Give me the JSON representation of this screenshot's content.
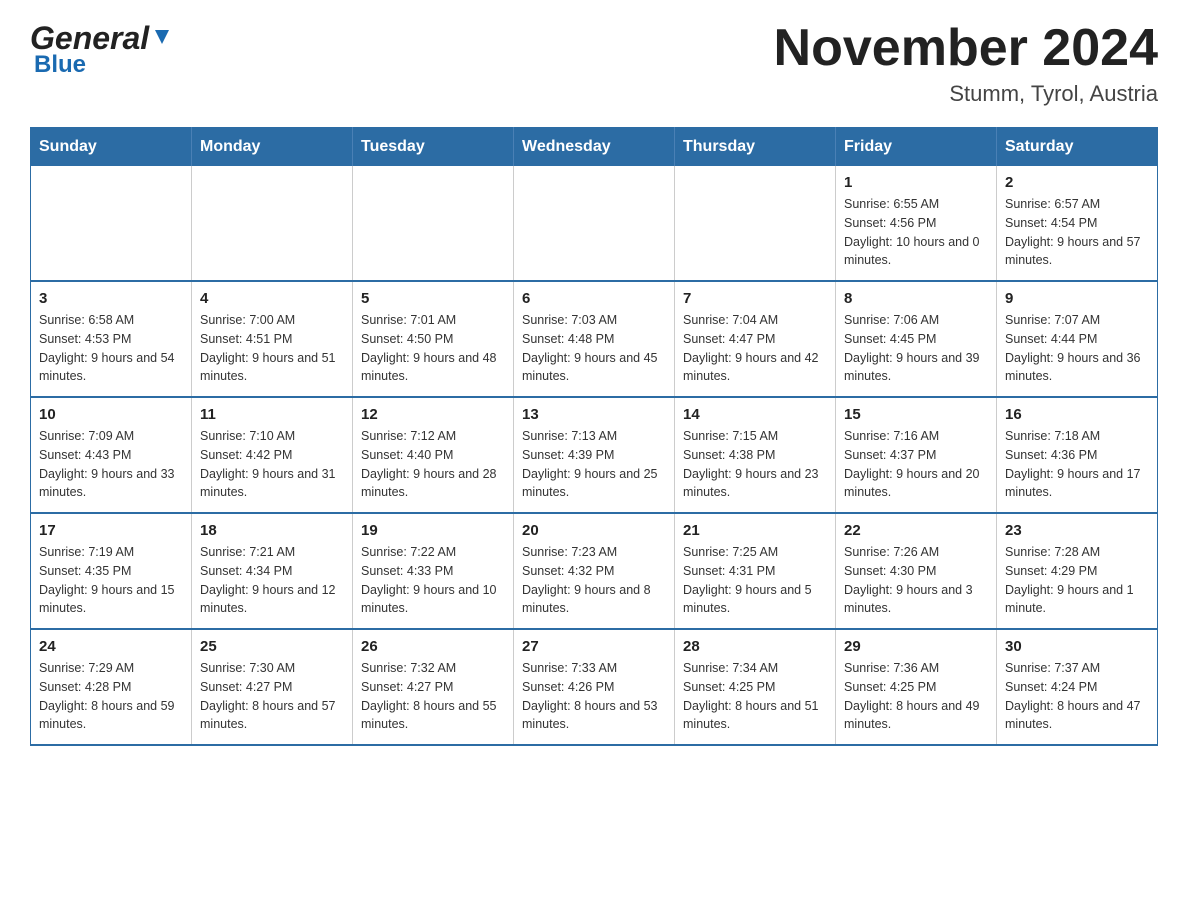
{
  "header": {
    "logo_general": "General",
    "logo_blue": "Blue",
    "month_year": "November 2024",
    "location": "Stumm, Tyrol, Austria"
  },
  "weekdays": [
    "Sunday",
    "Monday",
    "Tuesday",
    "Wednesday",
    "Thursday",
    "Friday",
    "Saturday"
  ],
  "weeks": [
    [
      {
        "day": "",
        "info": ""
      },
      {
        "day": "",
        "info": ""
      },
      {
        "day": "",
        "info": ""
      },
      {
        "day": "",
        "info": ""
      },
      {
        "day": "",
        "info": ""
      },
      {
        "day": "1",
        "info": "Sunrise: 6:55 AM\nSunset: 4:56 PM\nDaylight: 10 hours and 0 minutes."
      },
      {
        "day": "2",
        "info": "Sunrise: 6:57 AM\nSunset: 4:54 PM\nDaylight: 9 hours and 57 minutes."
      }
    ],
    [
      {
        "day": "3",
        "info": "Sunrise: 6:58 AM\nSunset: 4:53 PM\nDaylight: 9 hours and 54 minutes."
      },
      {
        "day": "4",
        "info": "Sunrise: 7:00 AM\nSunset: 4:51 PM\nDaylight: 9 hours and 51 minutes."
      },
      {
        "day": "5",
        "info": "Sunrise: 7:01 AM\nSunset: 4:50 PM\nDaylight: 9 hours and 48 minutes."
      },
      {
        "day": "6",
        "info": "Sunrise: 7:03 AM\nSunset: 4:48 PM\nDaylight: 9 hours and 45 minutes."
      },
      {
        "day": "7",
        "info": "Sunrise: 7:04 AM\nSunset: 4:47 PM\nDaylight: 9 hours and 42 minutes."
      },
      {
        "day": "8",
        "info": "Sunrise: 7:06 AM\nSunset: 4:45 PM\nDaylight: 9 hours and 39 minutes."
      },
      {
        "day": "9",
        "info": "Sunrise: 7:07 AM\nSunset: 4:44 PM\nDaylight: 9 hours and 36 minutes."
      }
    ],
    [
      {
        "day": "10",
        "info": "Sunrise: 7:09 AM\nSunset: 4:43 PM\nDaylight: 9 hours and 33 minutes."
      },
      {
        "day": "11",
        "info": "Sunrise: 7:10 AM\nSunset: 4:42 PM\nDaylight: 9 hours and 31 minutes."
      },
      {
        "day": "12",
        "info": "Sunrise: 7:12 AM\nSunset: 4:40 PM\nDaylight: 9 hours and 28 minutes."
      },
      {
        "day": "13",
        "info": "Sunrise: 7:13 AM\nSunset: 4:39 PM\nDaylight: 9 hours and 25 minutes."
      },
      {
        "day": "14",
        "info": "Sunrise: 7:15 AM\nSunset: 4:38 PM\nDaylight: 9 hours and 23 minutes."
      },
      {
        "day": "15",
        "info": "Sunrise: 7:16 AM\nSunset: 4:37 PM\nDaylight: 9 hours and 20 minutes."
      },
      {
        "day": "16",
        "info": "Sunrise: 7:18 AM\nSunset: 4:36 PM\nDaylight: 9 hours and 17 minutes."
      }
    ],
    [
      {
        "day": "17",
        "info": "Sunrise: 7:19 AM\nSunset: 4:35 PM\nDaylight: 9 hours and 15 minutes."
      },
      {
        "day": "18",
        "info": "Sunrise: 7:21 AM\nSunset: 4:34 PM\nDaylight: 9 hours and 12 minutes."
      },
      {
        "day": "19",
        "info": "Sunrise: 7:22 AM\nSunset: 4:33 PM\nDaylight: 9 hours and 10 minutes."
      },
      {
        "day": "20",
        "info": "Sunrise: 7:23 AM\nSunset: 4:32 PM\nDaylight: 9 hours and 8 minutes."
      },
      {
        "day": "21",
        "info": "Sunrise: 7:25 AM\nSunset: 4:31 PM\nDaylight: 9 hours and 5 minutes."
      },
      {
        "day": "22",
        "info": "Sunrise: 7:26 AM\nSunset: 4:30 PM\nDaylight: 9 hours and 3 minutes."
      },
      {
        "day": "23",
        "info": "Sunrise: 7:28 AM\nSunset: 4:29 PM\nDaylight: 9 hours and 1 minute."
      }
    ],
    [
      {
        "day": "24",
        "info": "Sunrise: 7:29 AM\nSunset: 4:28 PM\nDaylight: 8 hours and 59 minutes."
      },
      {
        "day": "25",
        "info": "Sunrise: 7:30 AM\nSunset: 4:27 PM\nDaylight: 8 hours and 57 minutes."
      },
      {
        "day": "26",
        "info": "Sunrise: 7:32 AM\nSunset: 4:27 PM\nDaylight: 8 hours and 55 minutes."
      },
      {
        "day": "27",
        "info": "Sunrise: 7:33 AM\nSunset: 4:26 PM\nDaylight: 8 hours and 53 minutes."
      },
      {
        "day": "28",
        "info": "Sunrise: 7:34 AM\nSunset: 4:25 PM\nDaylight: 8 hours and 51 minutes."
      },
      {
        "day": "29",
        "info": "Sunrise: 7:36 AM\nSunset: 4:25 PM\nDaylight: 8 hours and 49 minutes."
      },
      {
        "day": "30",
        "info": "Sunrise: 7:37 AM\nSunset: 4:24 PM\nDaylight: 8 hours and 47 minutes."
      }
    ]
  ]
}
